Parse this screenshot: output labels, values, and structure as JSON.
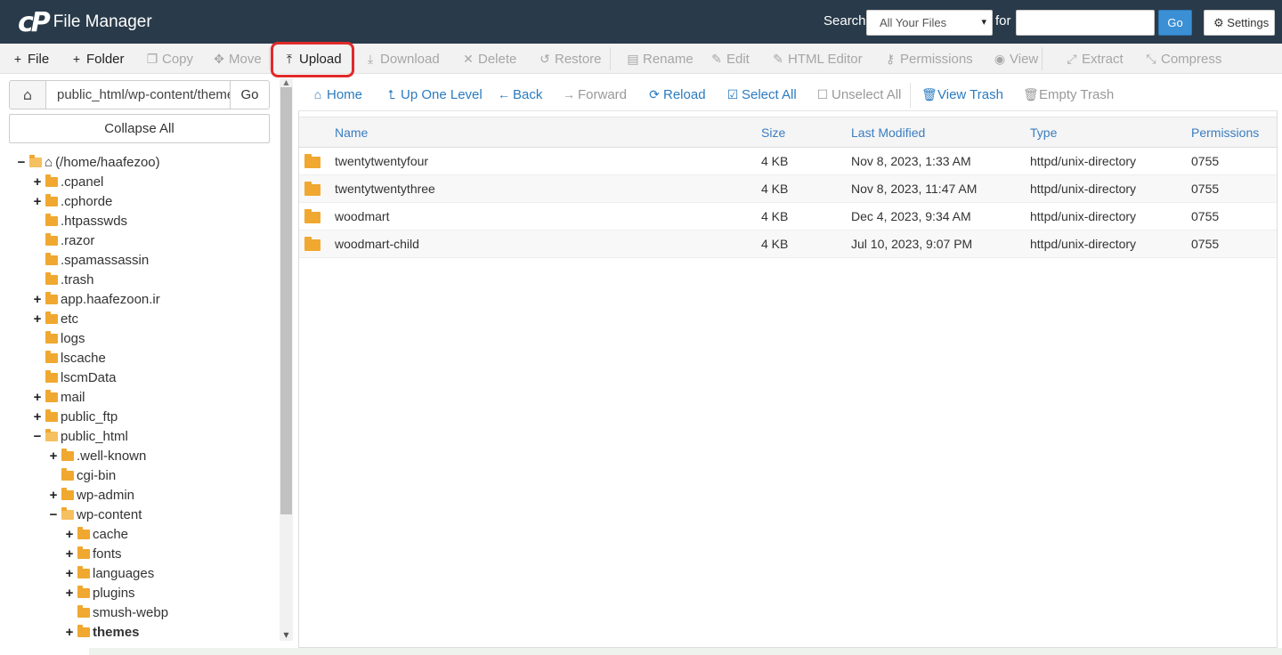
{
  "header": {
    "logo_text": "cP",
    "app_title": "File Manager",
    "search_label": "Search",
    "search_scope": "All Your Files",
    "for_label": "for",
    "search_value": "",
    "go_label": "Go",
    "settings_label": "Settings"
  },
  "toolbar": [
    {
      "label": "File",
      "icon": "+",
      "name": "new-file-button",
      "state": "active"
    },
    {
      "label": "Folder",
      "icon": "+",
      "name": "new-folder-button",
      "state": "active"
    },
    {
      "label": "Copy",
      "icon": "❐",
      "name": "copy-button",
      "state": "disabled"
    },
    {
      "label": "Move",
      "icon": "✥",
      "name": "move-button",
      "state": "disabled"
    },
    {
      "label": "Upload",
      "icon": "⤒",
      "name": "upload-button",
      "state": "active"
    },
    {
      "label": "Download",
      "icon": "⤓",
      "name": "download-button",
      "state": "disabled"
    },
    {
      "label": "Delete",
      "icon": "✕",
      "name": "delete-button",
      "state": "disabled"
    },
    {
      "label": "Restore",
      "icon": "↺",
      "name": "restore-button",
      "state": "disabled"
    },
    {
      "label": "Rename",
      "icon": "▤",
      "name": "rename-button",
      "state": "disabled"
    },
    {
      "label": "Edit",
      "icon": "✎",
      "name": "edit-button",
      "state": "disabled"
    },
    {
      "label": "HTML Editor",
      "icon": "✎",
      "name": "html-editor-button",
      "state": "disabled"
    },
    {
      "label": "Permissions",
      "icon": "⚷",
      "name": "permissions-button",
      "state": "disabled"
    },
    {
      "label": "View",
      "icon": "◉",
      "name": "view-button",
      "state": "disabled"
    },
    {
      "label": "Extract",
      "icon": "⤢",
      "name": "extract-button",
      "state": "disabled"
    },
    {
      "label": "Compress",
      "icon": "⤡",
      "name": "compress-button",
      "state": "disabled"
    }
  ],
  "left": {
    "path_value": "public_html/wp-content/themes",
    "go_label": "Go",
    "collapse_label": "Collapse All",
    "tree": [
      {
        "label": "(/home/haafezoo)",
        "depth": 0,
        "toggle": "−",
        "open": true,
        "home": true
      },
      {
        "label": ".cpanel",
        "depth": 1,
        "toggle": "+"
      },
      {
        "label": ".cphorde",
        "depth": 1,
        "toggle": "+"
      },
      {
        "label": ".htpasswds",
        "depth": 1,
        "toggle": ""
      },
      {
        "label": ".razor",
        "depth": 1,
        "toggle": ""
      },
      {
        "label": ".spamassassin",
        "depth": 1,
        "toggle": ""
      },
      {
        "label": ".trash",
        "depth": 1,
        "toggle": ""
      },
      {
        "label": "app.haafezoon.ir",
        "depth": 1,
        "toggle": "+"
      },
      {
        "label": "etc",
        "depth": 1,
        "toggle": "+"
      },
      {
        "label": "logs",
        "depth": 1,
        "toggle": ""
      },
      {
        "label": "lscache",
        "depth": 1,
        "toggle": ""
      },
      {
        "label": "lscmData",
        "depth": 1,
        "toggle": ""
      },
      {
        "label": "mail",
        "depth": 1,
        "toggle": "+"
      },
      {
        "label": "public_ftp",
        "depth": 1,
        "toggle": "+"
      },
      {
        "label": "public_html",
        "depth": 1,
        "toggle": "−",
        "open": true
      },
      {
        "label": ".well-known",
        "depth": 2,
        "toggle": "+"
      },
      {
        "label": "cgi-bin",
        "depth": 2,
        "toggle": ""
      },
      {
        "label": "wp-admin",
        "depth": 2,
        "toggle": "+"
      },
      {
        "label": "wp-content",
        "depth": 2,
        "toggle": "−",
        "open": true
      },
      {
        "label": "cache",
        "depth": 3,
        "toggle": "+"
      },
      {
        "label": "fonts",
        "depth": 3,
        "toggle": "+"
      },
      {
        "label": "languages",
        "depth": 3,
        "toggle": "+"
      },
      {
        "label": "plugins",
        "depth": 3,
        "toggle": "+"
      },
      {
        "label": "smush-webp",
        "depth": 3,
        "toggle": ""
      },
      {
        "label": "themes",
        "depth": 3,
        "toggle": "+",
        "bold": true
      }
    ]
  },
  "nav": [
    {
      "label": "Home",
      "icon": "⌂",
      "name": "nav-home-button",
      "state": "active"
    },
    {
      "label": "Up One Level",
      "icon": "⮤",
      "name": "nav-up-one-level-button",
      "state": "active"
    },
    {
      "label": "Back",
      "icon": "←",
      "name": "nav-back-button",
      "state": "active"
    },
    {
      "label": "Forward",
      "icon": "→",
      "name": "nav-forward-button",
      "state": "disabled"
    },
    {
      "label": "Reload",
      "icon": "⟳",
      "name": "nav-reload-button",
      "state": "active"
    },
    {
      "label": "Select All",
      "icon": "☑",
      "name": "nav-select-all-button",
      "state": "active"
    },
    {
      "label": "Unselect All",
      "icon": "☐",
      "name": "nav-unselect-all-button",
      "state": "disabled"
    },
    {
      "label": "View Trash",
      "icon": "🗑",
      "name": "nav-view-trash-button",
      "state": "active"
    },
    {
      "label": "Empty Trash",
      "icon": "🗑",
      "name": "nav-empty-trash-button",
      "state": "disabled"
    }
  ],
  "table": {
    "columns": [
      "Name",
      "Size",
      "Last Modified",
      "Type",
      "Permissions"
    ],
    "rows": [
      [
        "twentytwentyfour",
        "4 KB",
        "Nov 8, 2023, 1:33 AM",
        "httpd/unix-directory",
        "0755"
      ],
      [
        "twentytwentythree",
        "4 KB",
        "Nov 8, 2023, 11:47 AM",
        "httpd/unix-directory",
        "0755"
      ],
      [
        "woodmart",
        "4 KB",
        "Dec 4, 2023, 9:34 AM",
        "httpd/unix-directory",
        "0755"
      ],
      [
        "woodmart-child",
        "4 KB",
        "Jul 10, 2023, 9:07 PM",
        "httpd/unix-directory",
        "0755"
      ]
    ]
  },
  "colors": {
    "header_bg": "#293a4a",
    "accent": "#2b7bc0",
    "folder": "#f0a830",
    "highlight": "#e12a2a"
  }
}
